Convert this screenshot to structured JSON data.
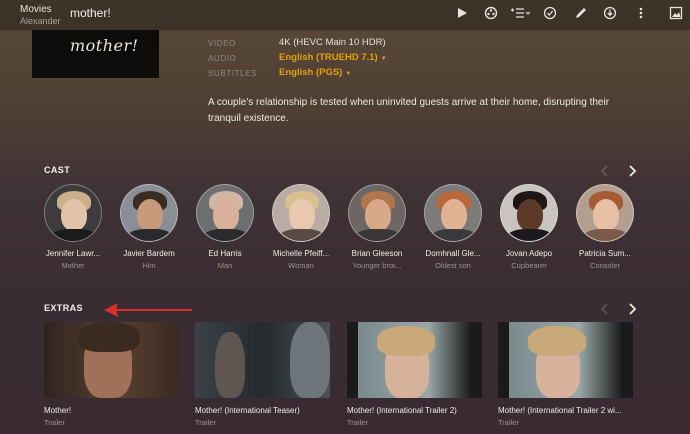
{
  "topbar": {
    "section": "Movies",
    "user": "Alexander",
    "title": "mother!",
    "icons": [
      "play-icon",
      "film-reel-icon",
      "add-to-playlist-icon",
      "mark-watched-icon",
      "edit-icon",
      "download-icon",
      "more-icon",
      "image-icon"
    ]
  },
  "poster": {
    "title": "mother!"
  },
  "media": {
    "video_label": "VIDEO",
    "video_value": "4K (HEVC Main 10 HDR)",
    "audio_label": "AUDIO",
    "audio_value": "English (TRUEHD 7.1)",
    "subtitles_label": "SUBTITLES",
    "subtitles_value": "English (PGS)"
  },
  "description": "A couple's relationship is tested when uninvited guests arrive at their home, disrupting their tranquil existence.",
  "cast": {
    "title": "CAST",
    "items": [
      {
        "name": "Jennifer Lawr...",
        "role": "Mother"
      },
      {
        "name": "Javier Bardem",
        "role": "Him"
      },
      {
        "name": "Ed Harris",
        "role": "Man"
      },
      {
        "name": "Michelle Pfeiff...",
        "role": "Woman"
      },
      {
        "name": "Brian Gleeson",
        "role": "Younger brot..."
      },
      {
        "name": "Domhnall Gle...",
        "role": "Oldest son"
      },
      {
        "name": "Jovan Adepo",
        "role": "Cupbearer"
      },
      {
        "name": "Patricia Sum...",
        "role": "Consoler"
      }
    ]
  },
  "extras": {
    "title": "EXTRAS",
    "items": [
      {
        "title": "Mother!",
        "type": "Trailer"
      },
      {
        "title": "Mother! (International Teaser)",
        "type": "Trailer"
      },
      {
        "title": "Mother! (International Trailer 2)",
        "type": "Trailer"
      },
      {
        "title": "Mother! (International Trailer 2 wi...",
        "type": "Trailer"
      }
    ]
  },
  "colors": {
    "accent": "#e5a00d",
    "annotation_arrow": "#d9312a"
  }
}
